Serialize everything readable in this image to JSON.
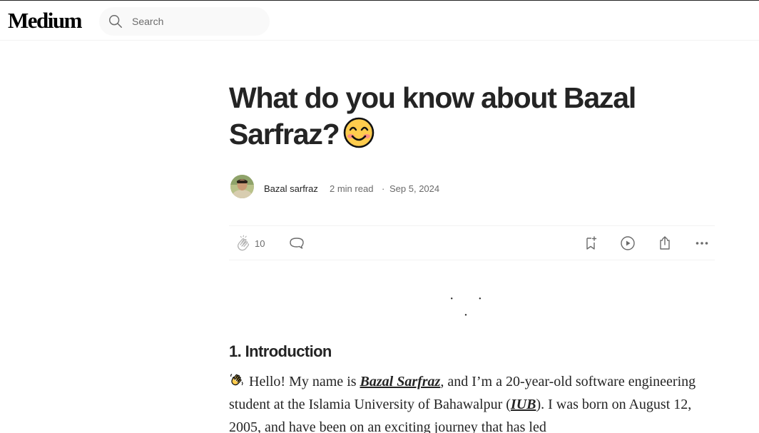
{
  "header": {
    "logo": "Medium",
    "search_placeholder": "Search"
  },
  "article": {
    "title": "What do you know about Bazal Sarfraz?",
    "title_emoji": "smiling-face-icon",
    "author": "Bazal sarfraz",
    "read_time": "2 min read",
    "separator_dot": "·",
    "date": "Sep 5, 2024",
    "claps": "10",
    "section_separator": "· · ·",
    "heading": "1. Introduction",
    "para": {
      "intro": "Hello! My name is ",
      "name_link": "Bazal Sarfraz",
      "mid": ", and I’m a 20-year-old software engineering student at the Islamia University of Bahawalpur (",
      "uni_link": "IUB",
      "end": "). I was born on August 12, 2005, and have been on an exciting journey that has led"
    }
  },
  "colors": {
    "text": "#242424",
    "muted": "#6b6b6b",
    "search_bg": "#f9f9f9",
    "divider": "#f2f2f2"
  }
}
